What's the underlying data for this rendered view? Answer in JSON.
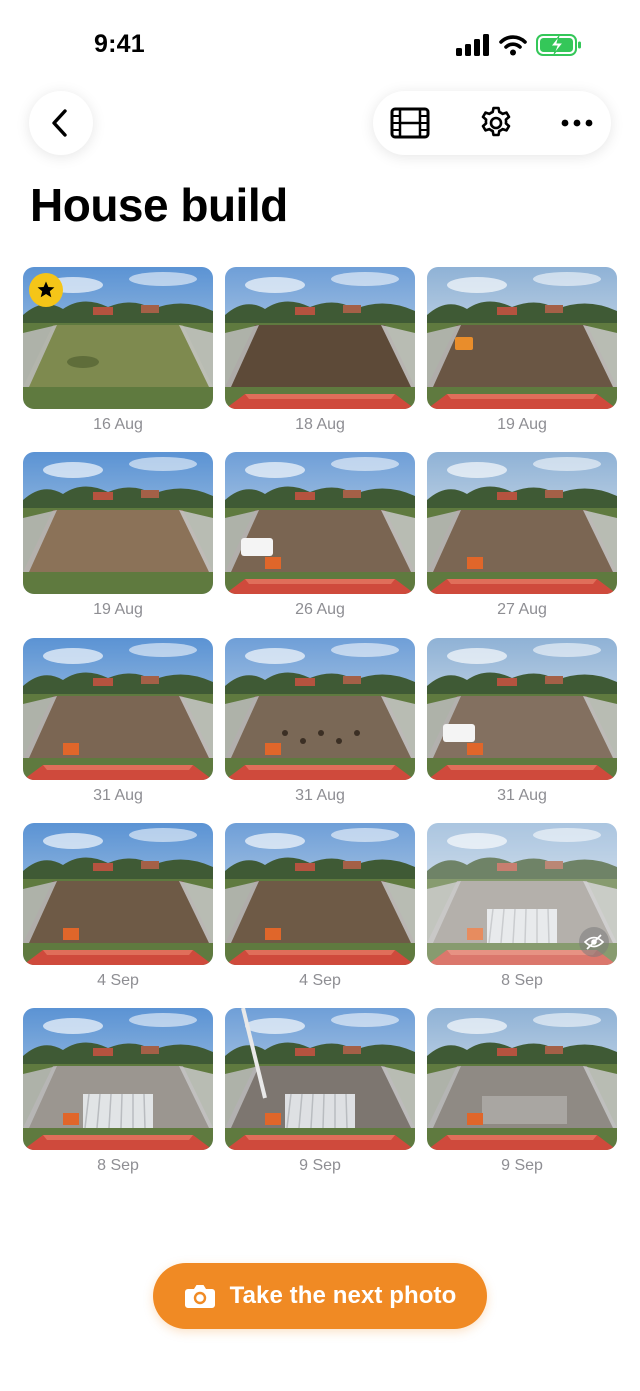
{
  "status_bar": {
    "time": "9:41"
  },
  "header": {
    "title": "House build"
  },
  "toolbar": {
    "back_icon": "chevron-left-icon",
    "video_icon": "film-icon",
    "settings_icon": "gear-icon",
    "more_icon": "ellipsis-icon"
  },
  "photos": [
    {
      "date": "16 Aug",
      "stage": "grass",
      "favorite": true
    },
    {
      "date": "18 Aug",
      "stage": "dirt"
    },
    {
      "date": "19 Aug",
      "stage": "excavator"
    },
    {
      "date": "19 Aug",
      "stage": "graded"
    },
    {
      "date": "26 Aug",
      "stage": "ute"
    },
    {
      "date": "27 Aug",
      "stage": "materials"
    },
    {
      "date": "31 Aug",
      "stage": "materials"
    },
    {
      "date": "31 Aug",
      "stage": "holes"
    },
    {
      "date": "31 Aug",
      "stage": "truck"
    },
    {
      "date": "4 Sep",
      "stage": "trench"
    },
    {
      "date": "4 Sep",
      "stage": "trench"
    },
    {
      "date": "8 Sep",
      "stage": "pods",
      "hidden": true
    },
    {
      "date": "8 Sep",
      "stage": "pods"
    },
    {
      "date": "9 Sep",
      "stage": "pump"
    },
    {
      "date": "9 Sep",
      "stage": "slab"
    }
  ],
  "primary_action": {
    "label": "Take the next photo",
    "icon": "camera-icon"
  },
  "colors": {
    "accent": "#f08a24",
    "favorite": "#f5c518",
    "date_text": "#8e8e93"
  }
}
